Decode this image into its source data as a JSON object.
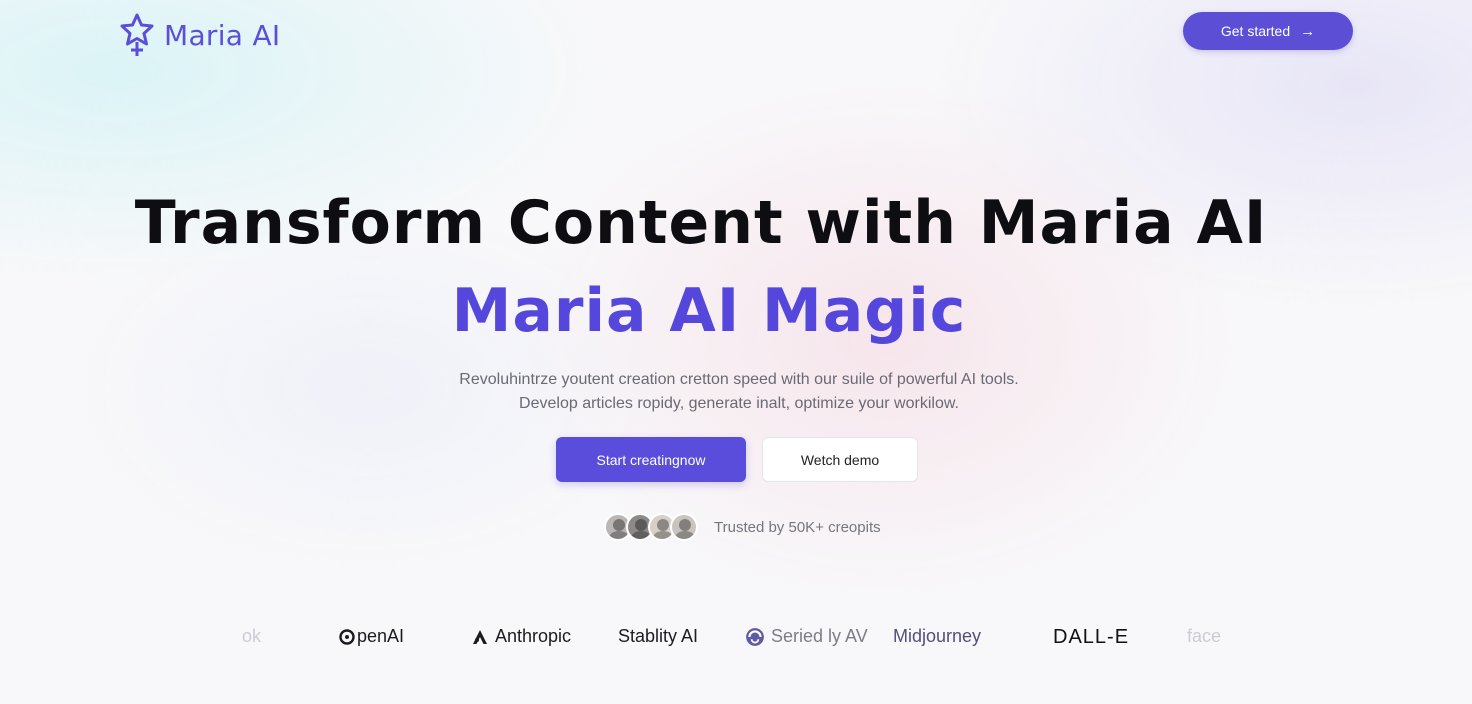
{
  "header": {
    "logo_text": "Maria AI",
    "logo_icon": "star-pin-icon",
    "cta_label": "Get started",
    "cta_icon": "arrow-right-icon"
  },
  "hero": {
    "headline": "Transform Content with Maria AI",
    "headline_accent": "Maria AI Magic",
    "subtitle_line1": "Revoluhintrze youtent creation cretton speed with our suile of powerful AI tools.",
    "subtitle_line2": "Develop articles ropidy, generate inalt, optimize your workilow.",
    "primary_cta": "Start creatingnow",
    "secondary_cta": "Wetch demo",
    "trust_text": "Trusted by 50K+ creopits"
  },
  "logos": {
    "items": [
      {
        "label": "ok",
        "icon": ""
      },
      {
        "label": "penAI",
        "icon": "openai-icon"
      },
      {
        "label": "Anthropic",
        "icon": "anthropic-icon"
      },
      {
        "label": "Stablity AI",
        "icon": ""
      },
      {
        "label": "Seried ly AV",
        "icon": "swirl-icon"
      },
      {
        "label": "Midjourney",
        "icon": ""
      },
      {
        "label": "DALL-E",
        "icon": ""
      },
      {
        "label": "face",
        "icon": ""
      }
    ]
  },
  "colors": {
    "accent": "#5a4ddc",
    "logo": "#5a4fd8",
    "headline": "#0d0d12"
  }
}
